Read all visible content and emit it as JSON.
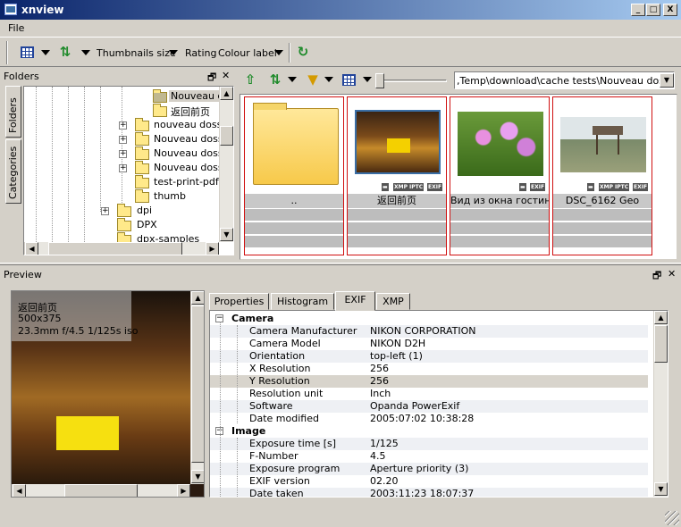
{
  "window": {
    "title": "xnview",
    "btn_min": "_",
    "btn_max": "□",
    "btn_close": "X"
  },
  "menu": {
    "file": "File"
  },
  "toolbar": {
    "thumb_size": "Thumbnails size",
    "rating": "Rating",
    "colour_label": "Colour label"
  },
  "folders_panel": {
    "title": "Folders",
    "tabs": [
      "Folders",
      "Categories"
    ],
    "items": [
      {
        "label": "Nouveau d",
        "selected": true
      },
      {
        "label": "返回前页"
      },
      {
        "label": "nouveau dossi"
      },
      {
        "label": "Nouveau doss"
      },
      {
        "label": "Nouveau doss"
      },
      {
        "label": "Nouveau doss"
      },
      {
        "label": "test-print-pdf"
      },
      {
        "label": "thumb"
      },
      {
        "label": "dpi"
      },
      {
        "label": "DPX"
      },
      {
        "label": "dpx-samples"
      }
    ]
  },
  "browser": {
    "path": ",Temp\\download\\cache tests\\Nouveau dossier\\",
    "thumbnails": [
      {
        "name": "..",
        "badges": []
      },
      {
        "name": "返回前页",
        "badges": [
          "XMP",
          "IPTC",
          "EXIF"
        ]
      },
      {
        "name": "Вид из окна гостин...",
        "badges": [
          "EXIF"
        ]
      },
      {
        "name": "DSC_6162 Geo",
        "badges": [
          "XMP",
          "IPTC",
          "EXIF"
        ]
      }
    ]
  },
  "preview_panel": {
    "title": "Preview",
    "overlay": {
      "name": "返回前页",
      "size": "500x375",
      "info": "23.3mm f/4.5 1/125s iso"
    }
  },
  "info_tabs": [
    "Properties",
    "Histogram",
    "EXIF",
    "XMP"
  ],
  "info_active_tab": "EXIF",
  "exif": {
    "groups": [
      {
        "name": "Camera",
        "rows": [
          {
            "k": "Camera Manufacturer",
            "v": "NIKON CORPORATION"
          },
          {
            "k": "Camera Model",
            "v": "NIKON D2H"
          },
          {
            "k": "Orientation",
            "v": "top-left (1)"
          },
          {
            "k": "X Resolution",
            "v": "256"
          },
          {
            "k": "Y Resolution",
            "v": "256",
            "selected": true
          },
          {
            "k": "Resolution unit",
            "v": "Inch"
          },
          {
            "k": "Software",
            "v": "Opanda PowerExif"
          },
          {
            "k": "Date modified",
            "v": "2005:07:02 10:38:28"
          }
        ]
      },
      {
        "name": "Image",
        "rows": [
          {
            "k": "Exposure time [s]",
            "v": "1/125"
          },
          {
            "k": "F-Number",
            "v": "4.5"
          },
          {
            "k": "Exposure program",
            "v": "Aperture priority (3)"
          },
          {
            "k": "EXIF version",
            "v": "02.20"
          },
          {
            "k": "Date taken",
            "v": "2003:11:23 18:07:37"
          }
        ]
      }
    ]
  }
}
